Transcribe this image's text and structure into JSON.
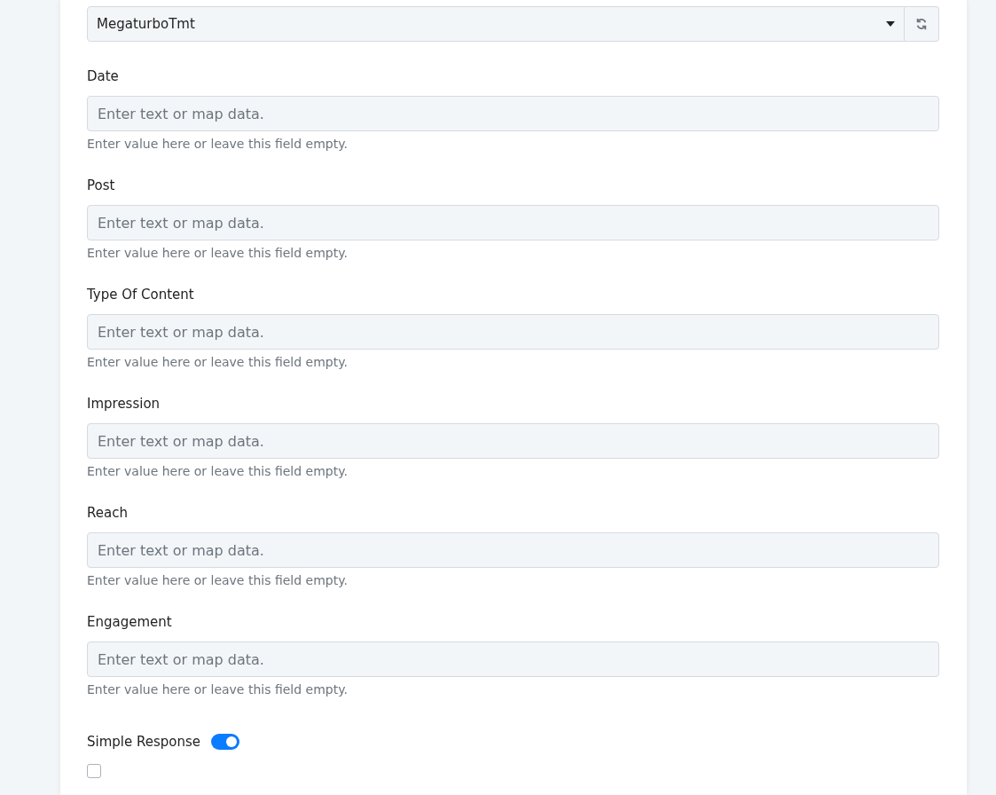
{
  "connection": {
    "value": "MegaturboTmt"
  },
  "fields": [
    {
      "label": "Date",
      "placeholder": "Enter text or map data.",
      "help": "Enter value here or leave this field empty."
    },
    {
      "label": "Post",
      "placeholder": "Enter text or map data.",
      "help": "Enter value here or leave this field empty."
    },
    {
      "label": "Type Of Content",
      "placeholder": "Enter text or map data.",
      "help": "Enter value here or leave this field empty."
    },
    {
      "label": "Impression",
      "placeholder": "Enter text or map data.",
      "help": "Enter value here or leave this field empty."
    },
    {
      "label": "Reach",
      "placeholder": "Enter text or map data.",
      "help": "Enter value here or leave this field empty."
    },
    {
      "label": "Engagement",
      "placeholder": "Enter text or map data.",
      "help": "Enter value here or leave this field empty."
    }
  ],
  "simple_response": {
    "label": "Simple Response",
    "on": true
  },
  "checkbox": {
    "checked": false
  }
}
